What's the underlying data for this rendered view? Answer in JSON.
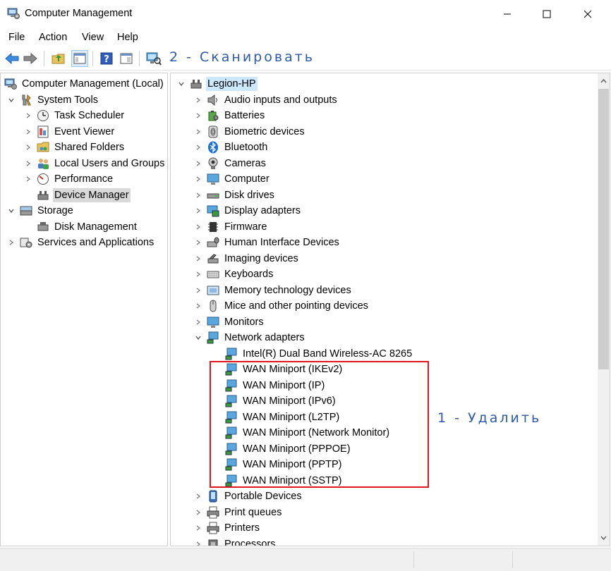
{
  "window": {
    "title": "Computer Management",
    "app_icon": "computer-management-icon",
    "controls": [
      "minimize-icon",
      "maximize-icon",
      "close-icon"
    ]
  },
  "menu": [
    "File",
    "Action",
    "View",
    "Help"
  ],
  "toolbar": {
    "buttons": [
      "back-arrow-icon",
      "forward-arrow-icon",
      "up-folder-icon",
      "show-hide-tree-icon",
      "help-icon",
      "properties-icon",
      "scan-hardware-icon"
    ],
    "annotation": "2 - Сканировать"
  },
  "left_tree": {
    "root": "Computer Management (Local)",
    "system_tools": "System Tools",
    "task_scheduler": "Task Scheduler",
    "event_viewer": "Event Viewer",
    "shared_folders": "Shared Folders",
    "local_users": "Local Users and Groups",
    "performance": "Performance",
    "device_manager": "Device Manager",
    "storage": "Storage",
    "disk_management": "Disk Management",
    "services": "Services and Applications"
  },
  "device_tree": {
    "root": "Legion-HP",
    "categories": {
      "audio": "Audio inputs and outputs",
      "batteries": "Batteries",
      "biometric": "Biometric devices",
      "bluetooth": "Bluetooth",
      "cameras": "Cameras",
      "computer": "Computer",
      "disk_drives": "Disk drives",
      "display": "Display adapters",
      "firmware": "Firmware",
      "hid": "Human Interface Devices",
      "imaging": "Imaging devices",
      "keyboards": "Keyboards",
      "memory": "Memory technology devices",
      "mice": "Mice and other pointing devices",
      "monitors": "Monitors",
      "network": "Network adapters",
      "portable": "Portable Devices",
      "print_queues": "Print queues",
      "printers": "Printers",
      "processors": "Processors"
    },
    "network_children": [
      "Intel(R) Dual Band Wireless-AC 8265",
      "WAN Miniport (IKEv2)",
      "WAN Miniport (IP)",
      "WAN Miniport (IPv6)",
      "WAN Miniport (L2TP)",
      "WAN Miniport (Network Monitor)",
      "WAN Miniport (PPPOE)",
      "WAN Miniport (PPTP)",
      "WAN Miniport (SSTP)"
    ],
    "annotation": "1 - Удалить",
    "highlight_color": "#e0181e"
  }
}
